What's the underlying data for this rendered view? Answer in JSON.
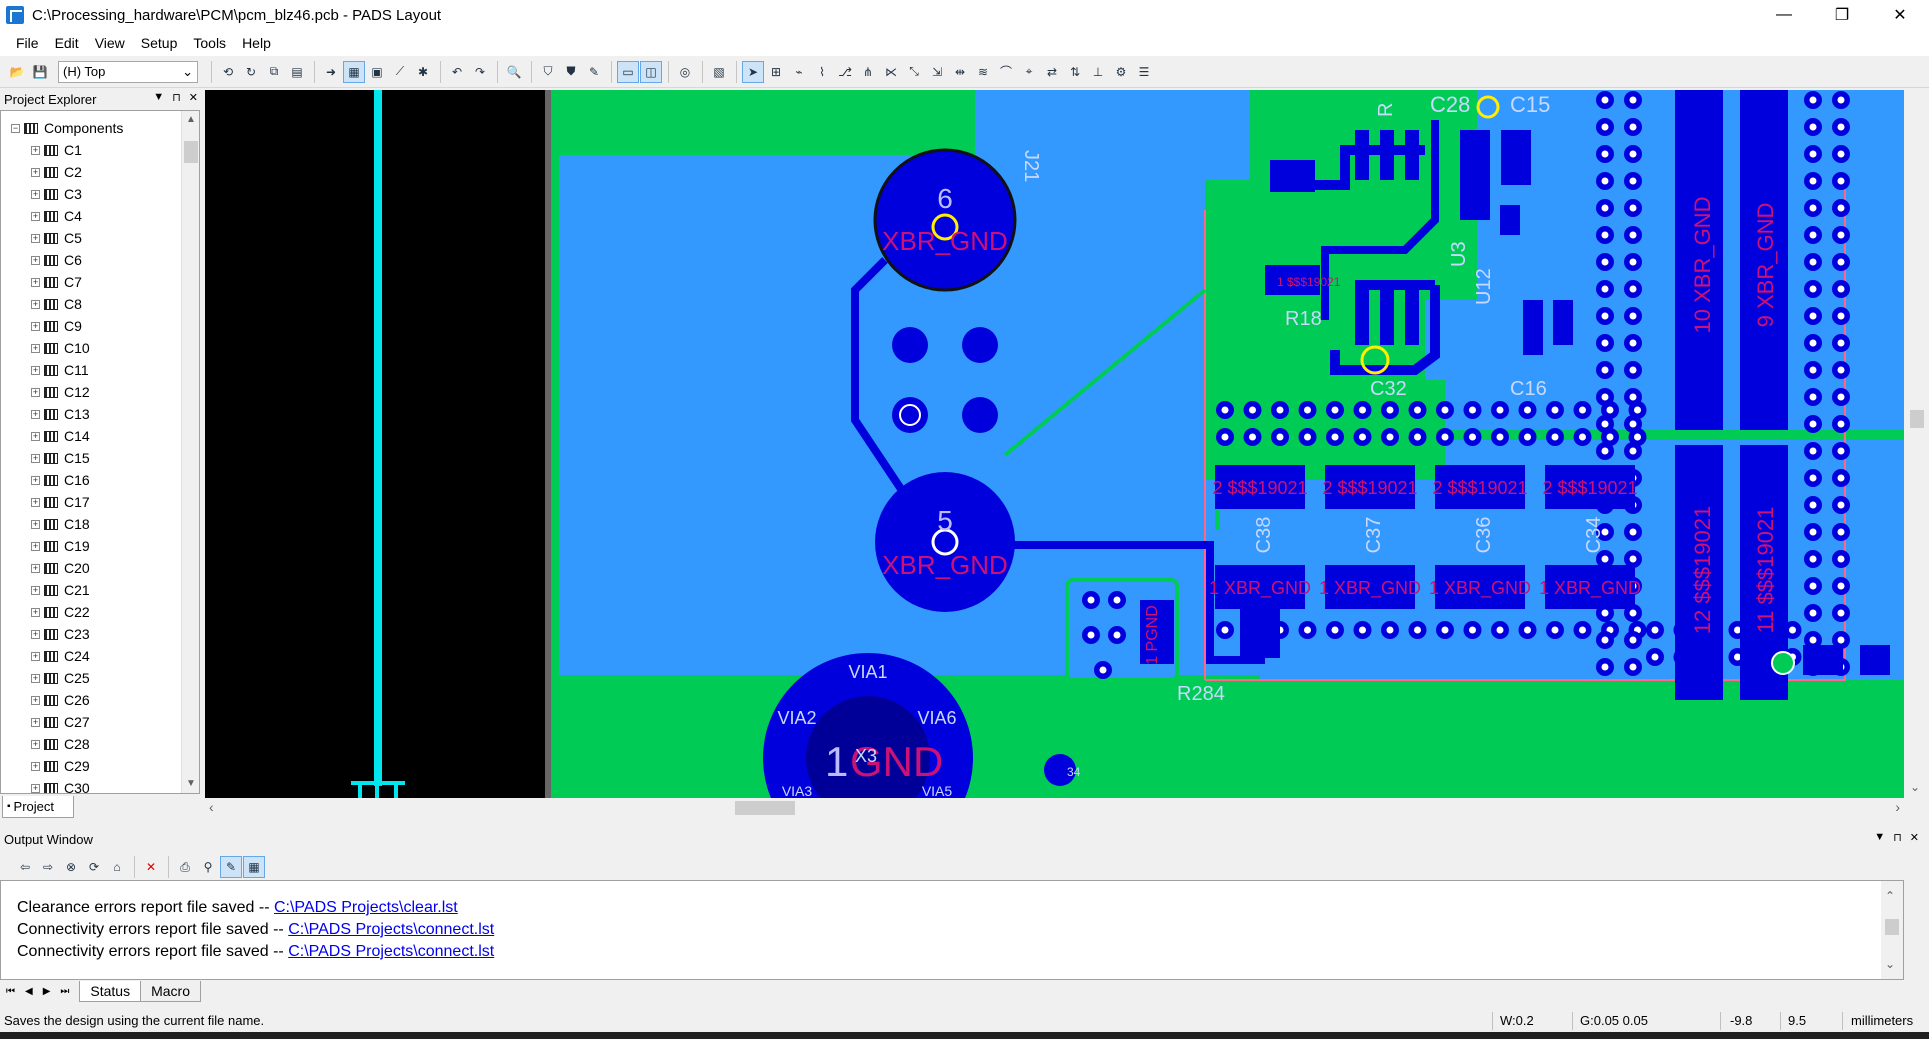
{
  "window": {
    "title": "C:\\Processing_hardware\\PCM\\pcm_blz46.pcb - PADS Layout",
    "minimize": "—",
    "maximize": "❐",
    "close": "✕"
  },
  "menu": [
    "File",
    "Edit",
    "View",
    "Setup",
    "Tools",
    "Help"
  ],
  "toolbar": {
    "layer": "(H) Top"
  },
  "explorer": {
    "title": "Project Explorer",
    "root": "Components",
    "items": [
      "C1",
      "C2",
      "C3",
      "C4",
      "C5",
      "C6",
      "C7",
      "C8",
      "C9",
      "C10",
      "C11",
      "C12",
      "C13",
      "C14",
      "C15",
      "C16",
      "C17",
      "C18",
      "C19",
      "C20",
      "C21",
      "C22",
      "C23",
      "C24",
      "C25",
      "C26",
      "C27",
      "C28",
      "C29",
      "C30"
    ],
    "tab": "Project"
  },
  "pcb": {
    "labels": {
      "j21": "J21",
      "c28": "C28",
      "c15": "C15",
      "u3": "U3",
      "u12": "U12",
      "r18": "R18",
      "c32": "C32",
      "c16": "C16",
      "c38": "C38",
      "c37": "C37",
      "c36": "C36",
      "c34": "C34",
      "r284": "R284",
      "r": "R",
      "via1": "VIA1",
      "via2": "VIA2",
      "via6": "VIA6",
      "via3": "VIA3",
      "via5": "VIA5",
      "x3": "X3"
    },
    "net_big_pad": "XBR_GND",
    "pin6": "6",
    "pin5": "5",
    "pin1gnd": "1",
    "gnd": "GND",
    "vert_labels": [
      "10 XBR_GND",
      "9 XBR_GND",
      "12 $$$19021",
      "11 $$$19021"
    ],
    "cap_top_pads": [
      "2 $$$19021",
      "2 $$$19021",
      "2 $$$19021",
      "2 $$$19021"
    ],
    "cap_bot_pads": [
      "1 XBR_GND",
      "1 XBR_GND",
      "1 XBR_GND",
      "1 XBR_GND"
    ],
    "r18_pad": "1 $$$19021",
    "pgnd": "1 PGND",
    "small_via": "34",
    "colors": {
      "copper_blue": "#3399ff",
      "pad_blue": "#0000dd",
      "green_fill": "#00cc55",
      "cyan_trace": "#00e5ee",
      "board_outline": "#ff6688"
    }
  },
  "output": {
    "title": "Output Window",
    "lines": [
      {
        "text": "Clearance errors report file saved -- ",
        "link": "C:\\PADS Projects\\clear.lst"
      },
      {
        "text": "Connectivity errors report file saved -- ",
        "link": "C:\\PADS Projects\\connect.lst"
      },
      {
        "text": "Connectivity errors report file saved -- ",
        "link": "C:\\PADS Projects\\connect.lst"
      }
    ],
    "tabs": [
      "Status",
      "Macro"
    ]
  },
  "status": {
    "message": "Saves the design using the current file name.",
    "width": "W:0.2",
    "grid": "G:0.05 0.05",
    "x": "-9.8",
    "y": "9.5",
    "units": "millimeters"
  }
}
